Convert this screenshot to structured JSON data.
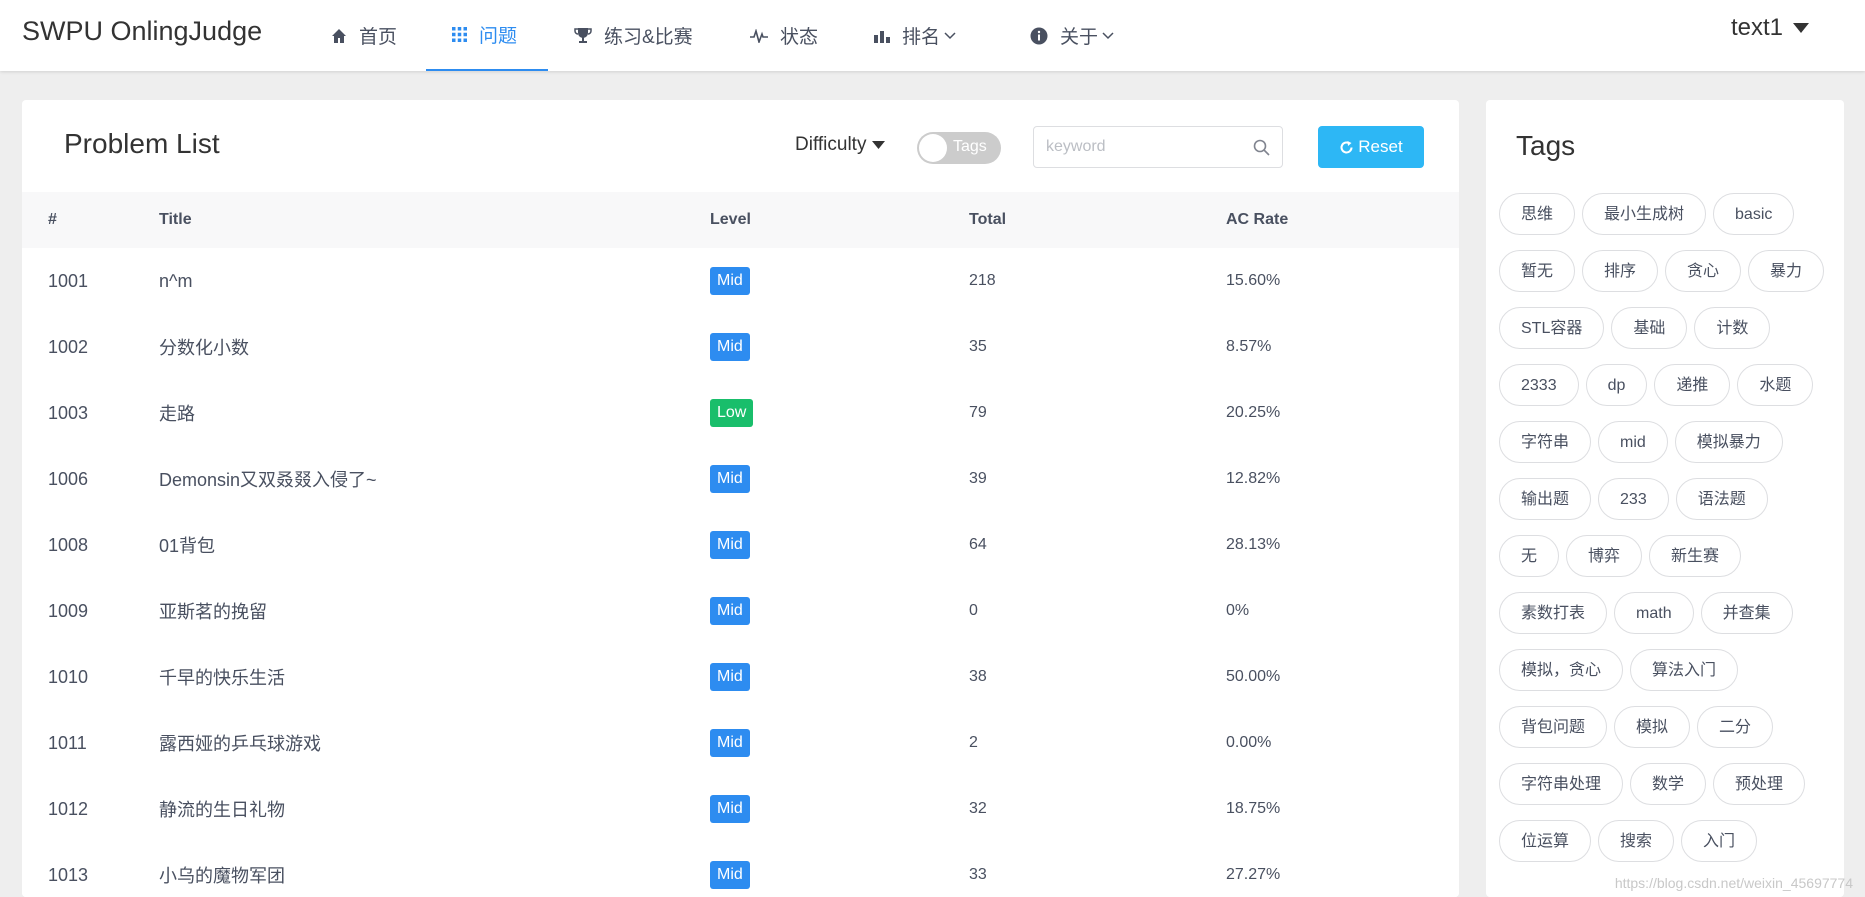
{
  "header": {
    "brand": "SWPU OnlingJudge",
    "nav": [
      {
        "label": "首页"
      },
      {
        "label": "问题"
      },
      {
        "label": "练习&比赛"
      },
      {
        "label": "状态"
      },
      {
        "label": "排名"
      },
      {
        "label": "关于"
      }
    ],
    "user": "text1"
  },
  "problem_list": {
    "title": "Problem List",
    "difficulty_label": "Difficulty",
    "tags_toggle_label": "Tags",
    "search_placeholder": "keyword",
    "reset_label": "Reset",
    "columns": [
      "#",
      "Title",
      "Level",
      "Total",
      "AC Rate"
    ],
    "rows": [
      {
        "id": "1001",
        "title": "n^m",
        "level": "Mid",
        "total": "218",
        "ac_rate": "15.60%"
      },
      {
        "id": "1002",
        "title": "分数化小数",
        "level": "Mid",
        "total": "35",
        "ac_rate": "8.57%"
      },
      {
        "id": "1003",
        "title": "走路",
        "level": "Low",
        "total": "79",
        "ac_rate": "20.25%"
      },
      {
        "id": "1006",
        "title": "Demonsin又双叒叕入侵了~",
        "level": "Mid",
        "total": "39",
        "ac_rate": "12.82%"
      },
      {
        "id": "1008",
        "title": "01背包",
        "level": "Mid",
        "total": "64",
        "ac_rate": "28.13%"
      },
      {
        "id": "1009",
        "title": "亚斯茗的挽留",
        "level": "Mid",
        "total": "0",
        "ac_rate": "0%"
      },
      {
        "id": "1010",
        "title": "千早的快乐生活",
        "level": "Mid",
        "total": "38",
        "ac_rate": "50.00%"
      },
      {
        "id": "1011",
        "title": "露西娅的乒乓球游戏",
        "level": "Mid",
        "total": "2",
        "ac_rate": "0.00%"
      },
      {
        "id": "1012",
        "title": "静流的生日礼物",
        "level": "Mid",
        "total": "32",
        "ac_rate": "18.75%"
      },
      {
        "id": "1013",
        "title": "小乌的魔物军团",
        "level": "Mid",
        "total": "33",
        "ac_rate": "27.27%"
      }
    ]
  },
  "level_colors": {
    "Mid": "#2d8cf0",
    "Low": "#19be6b"
  },
  "accent_color": "#2d8cf0",
  "tags_panel": {
    "title": "Tags",
    "tags": [
      "思维",
      "最小生成树",
      "basic",
      "暂无",
      "排序",
      "贪心",
      "暴力",
      "STL容器",
      "基础",
      "计数",
      "2333",
      "dp",
      "递推",
      "水题",
      "字符串",
      "mid",
      "模拟暴力",
      "输出题",
      "233",
      "语法题",
      "无",
      "博弈",
      "新生赛",
      "素数打表",
      "math",
      "并查集",
      "模拟，贪心",
      "算法入门",
      "背包问题",
      "模拟",
      "二分",
      "字符串处理",
      "数学",
      "预处理",
      "位运算",
      "搜索",
      "入门"
    ]
  },
  "watermark": "https://blog.csdn.net/weixin_45697774"
}
